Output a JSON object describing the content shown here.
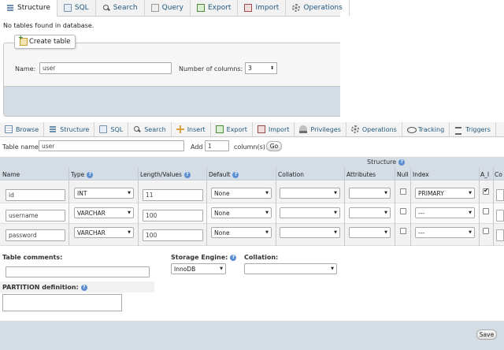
{
  "top_tabs": [
    {
      "label": "Structure",
      "icon": "structure-icon",
      "active": true
    },
    {
      "label": "SQL",
      "icon": "sql-icon"
    },
    {
      "label": "Search",
      "icon": "search-icon"
    },
    {
      "label": "Query",
      "icon": "query-icon"
    },
    {
      "label": "Export",
      "icon": "export-icon"
    },
    {
      "label": "Import",
      "icon": "import-icon"
    },
    {
      "label": "Operations",
      "icon": "operations-icon"
    }
  ],
  "no_tables_msg": "No tables found in database.",
  "create_table": {
    "legend": "Create table",
    "name_label": "Name:",
    "name_value": "user",
    "columns_label": "Number of columns:",
    "columns_value": "3"
  },
  "table_tabs": [
    {
      "label": "Browse",
      "icon": "browse-icon"
    },
    {
      "label": "Structure",
      "icon": "structure-icon"
    },
    {
      "label": "SQL",
      "icon": "sql-icon"
    },
    {
      "label": "Search",
      "icon": "search-icon"
    },
    {
      "label": "Insert",
      "icon": "insert-icon"
    },
    {
      "label": "Export",
      "icon": "export-icon"
    },
    {
      "label": "Import",
      "icon": "import-icon"
    },
    {
      "label": "Privileges",
      "icon": "privileges-icon"
    },
    {
      "label": "Operations",
      "icon": "operations-icon"
    },
    {
      "label": "Tracking",
      "icon": "tracking-icon"
    },
    {
      "label": "Triggers",
      "icon": "triggers-icon"
    }
  ],
  "table_form": {
    "table_name_label": "Table name:",
    "table_name_value": "user",
    "add_label": "Add",
    "add_value": "1",
    "columns_suffix": "column(s)",
    "go_label": "Go"
  },
  "grid": {
    "structure_label": "Structure",
    "headers": {
      "name": "Name",
      "type": "Type",
      "length": "Length/Values",
      "default": "Default",
      "collation": "Collation",
      "attributes": "Attributes",
      "null": "Null",
      "index": "Index",
      "ai": "A_I",
      "comments": "Co"
    },
    "rows": [
      {
        "name": "id",
        "type": "INT",
        "length": "11",
        "default": "None",
        "collation": "",
        "attributes": "",
        "null": false,
        "index": "PRIMARY",
        "ai": true
      },
      {
        "name": "username",
        "type": "VARCHAR",
        "length": "100",
        "default": "None",
        "collation": "",
        "attributes": "",
        "null": false,
        "index": "---",
        "ai": false
      },
      {
        "name": "password",
        "type": "VARCHAR",
        "length": "100",
        "default": "None",
        "collation": "",
        "attributes": "",
        "null": false,
        "index": "---",
        "ai": false
      }
    ]
  },
  "table_options": {
    "comments_label": "Table comments:",
    "engine_label": "Storage Engine:",
    "engine_value": "InnoDB",
    "collation_label": "Collation:",
    "collation_value": "",
    "partition_label": "PARTITION definition:"
  },
  "save_label": "Save"
}
